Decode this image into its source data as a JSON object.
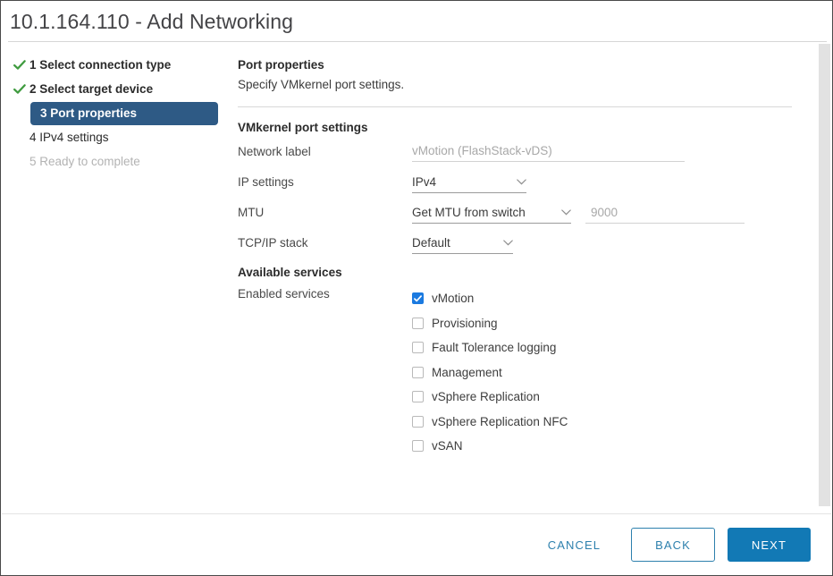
{
  "window": {
    "title": "10.1.164.110 - Add Networking"
  },
  "steps": [
    {
      "number": "1",
      "label": "1 Select connection type",
      "state": "done"
    },
    {
      "number": "2",
      "label": "2 Select target device",
      "state": "done"
    },
    {
      "number": "3",
      "label": "3 Port properties",
      "state": "active"
    },
    {
      "number": "4",
      "label": "4 IPv4 settings",
      "state": "pending"
    },
    {
      "number": "5",
      "label": "5 Ready to complete",
      "state": "disabled"
    }
  ],
  "panel": {
    "title": "Port properties",
    "subtitle": "Specify VMkernel port settings."
  },
  "form": {
    "section_heading": "VMkernel port settings",
    "network_label": {
      "label": "Network label",
      "value": "",
      "placeholder": "vMotion (FlashStack-vDS)"
    },
    "ip_settings": {
      "label": "IP settings",
      "value": "IPv4"
    },
    "mtu": {
      "label": "MTU",
      "value": "Get MTU from switch",
      "size_value": "",
      "size_placeholder": "9000"
    },
    "tcpip_stack": {
      "label": "TCP/IP stack",
      "value": "Default"
    }
  },
  "services": {
    "section_heading": "Available services",
    "label": "Enabled services",
    "items": [
      {
        "label": "vMotion",
        "checked": true
      },
      {
        "label": "Provisioning",
        "checked": false
      },
      {
        "label": "Fault Tolerance logging",
        "checked": false
      },
      {
        "label": "Management",
        "checked": false
      },
      {
        "label": "vSphere Replication",
        "checked": false
      },
      {
        "label": "vSphere Replication NFC",
        "checked": false
      },
      {
        "label": "vSAN",
        "checked": false
      }
    ]
  },
  "footer": {
    "cancel_label": "CANCEL",
    "back_label": "BACK",
    "next_label": "NEXT"
  },
  "colors": {
    "accent_primary": "#1279b5",
    "accent_link": "#2d80ad",
    "active_step_bg": "#2e5a85",
    "check_green": "#3f9b3f",
    "checkbox_blue": "#1b7ae0"
  }
}
